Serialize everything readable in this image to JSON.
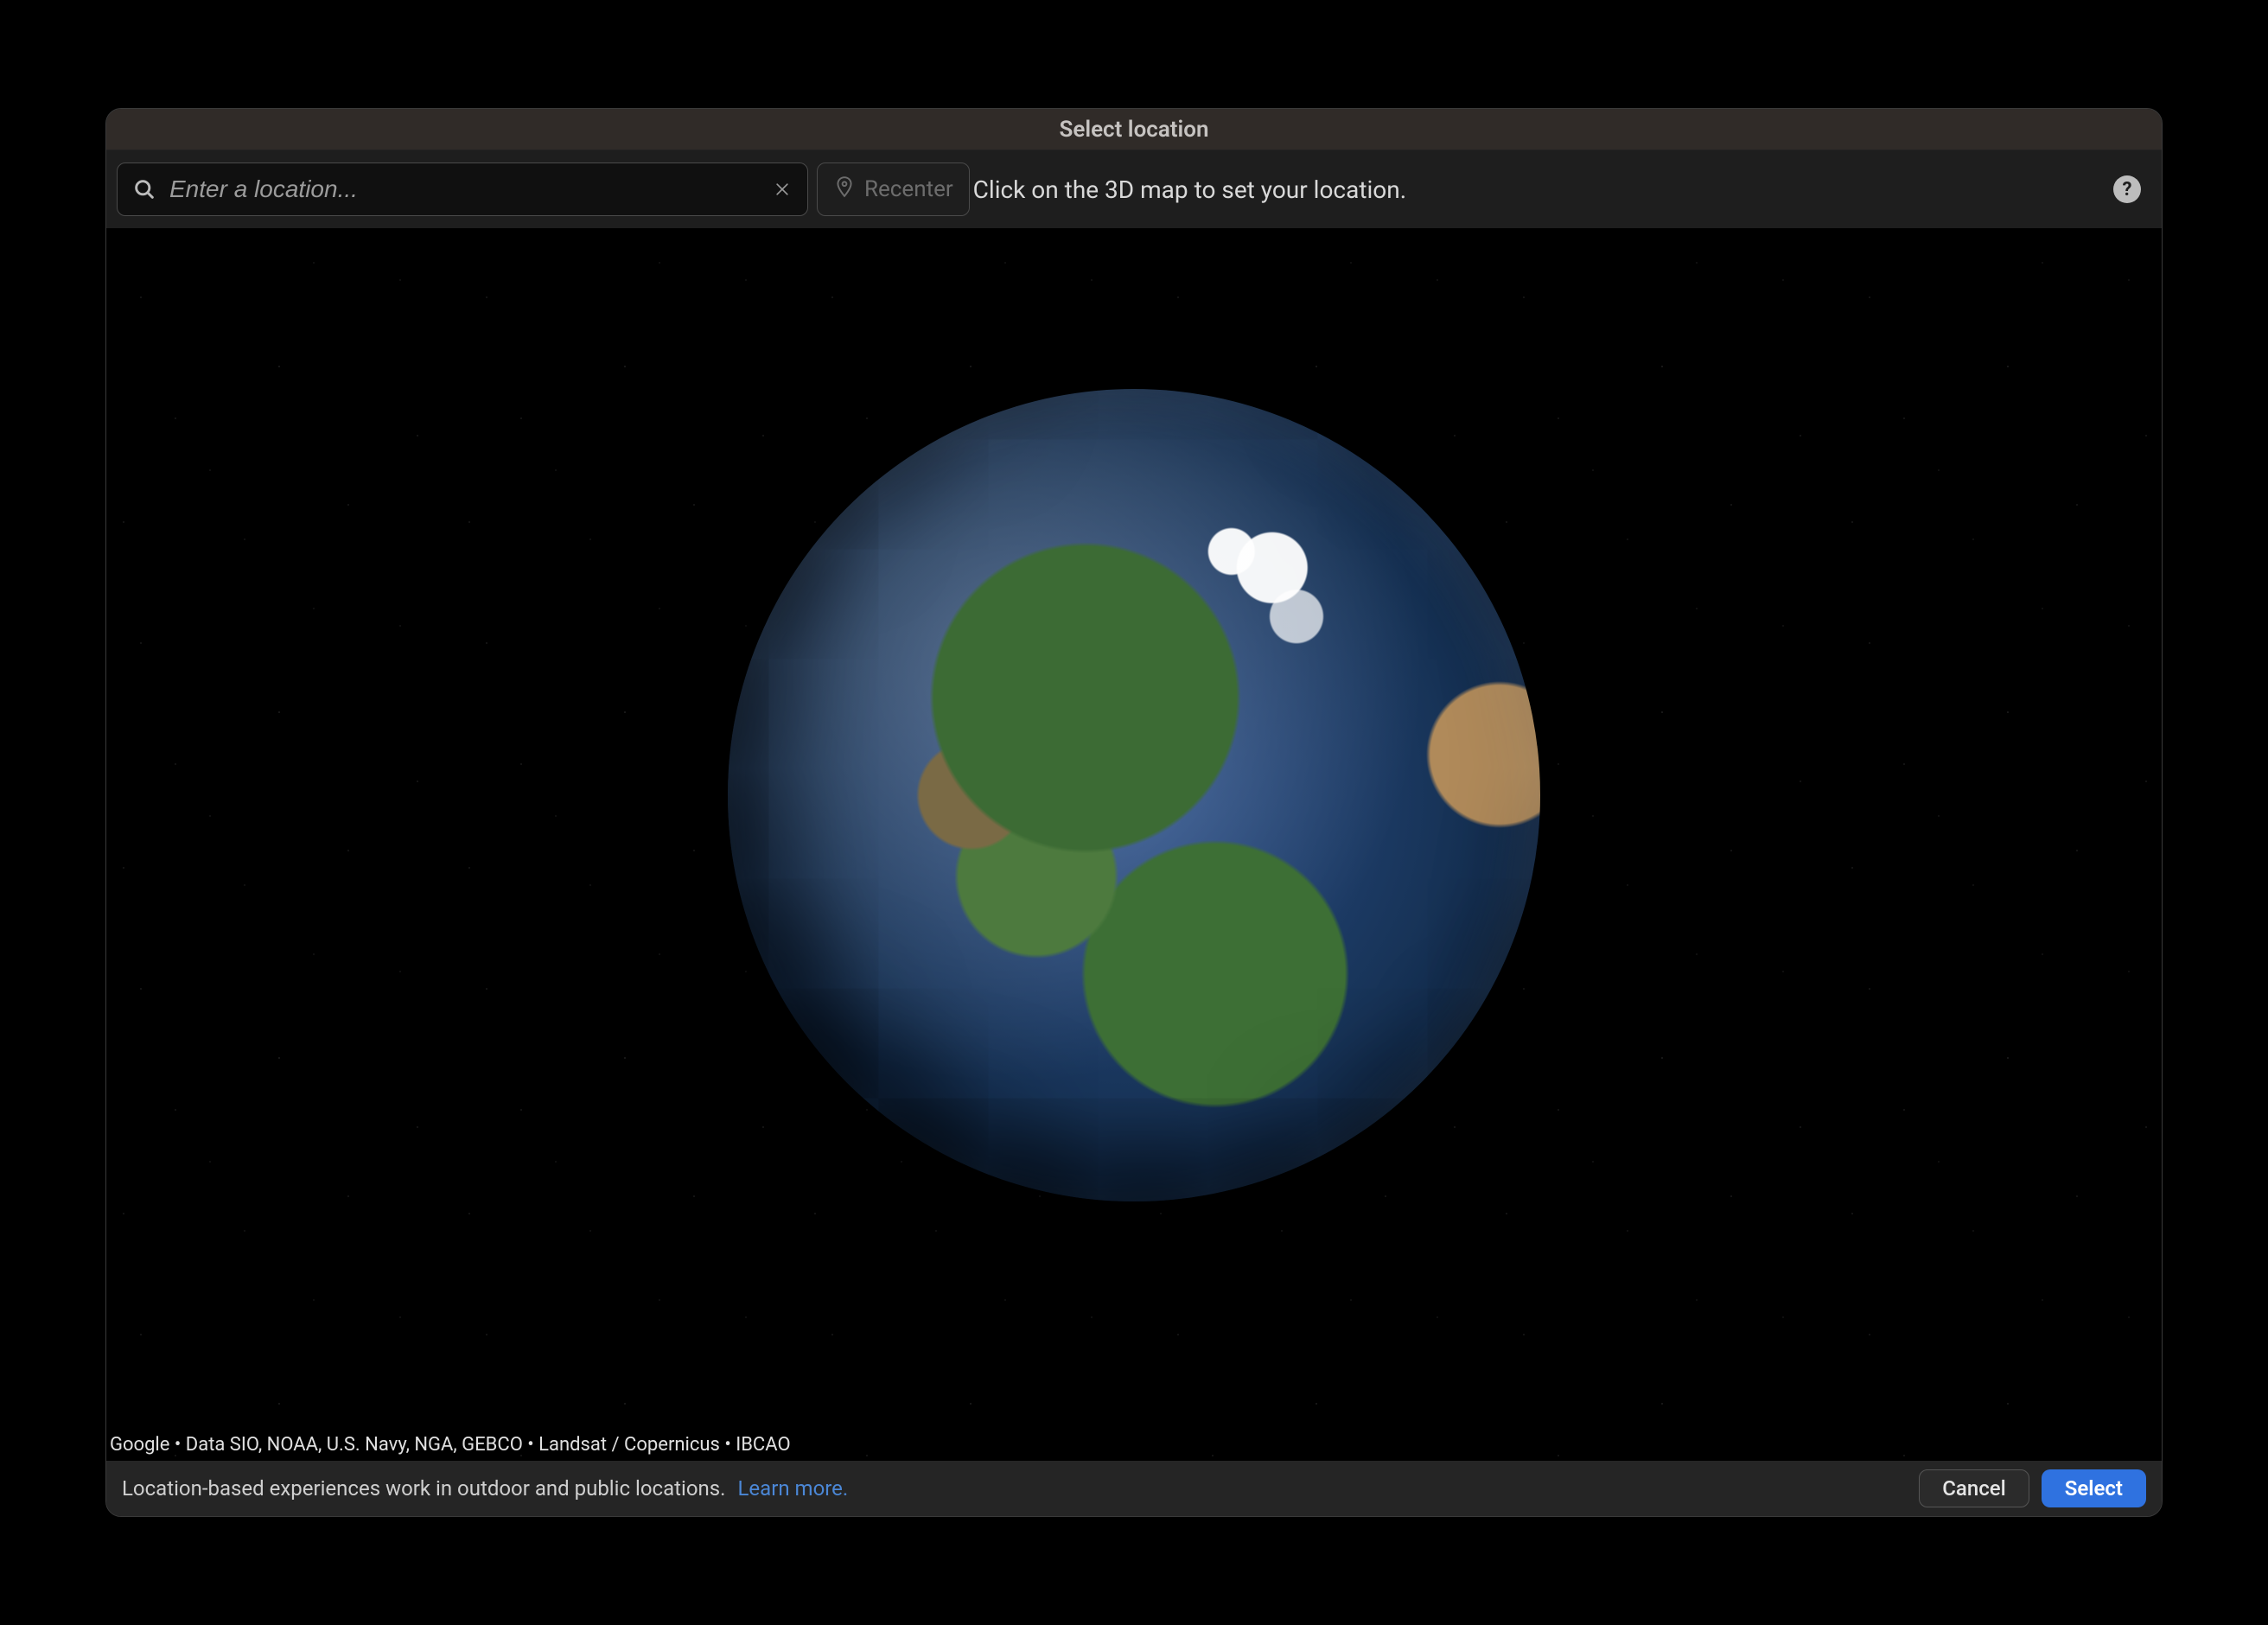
{
  "window": {
    "title": "Select location"
  },
  "toolbar": {
    "search_placeholder": "Enter a location...",
    "search_value": "",
    "recenter_label": "Recenter",
    "instruction": "Click on the 3D map to set your location.",
    "help_symbol": "?"
  },
  "map": {
    "attribution": "Google • Data SIO, NOAA, U.S. Navy, NGA, GEBCO • Landsat / Copernicus • IBCAO"
  },
  "footer": {
    "info_text": "Location-based experiences work in outdoor and public locations.",
    "learn_more_label": "Learn more.",
    "cancel_label": "Cancel",
    "select_label": "Select"
  }
}
